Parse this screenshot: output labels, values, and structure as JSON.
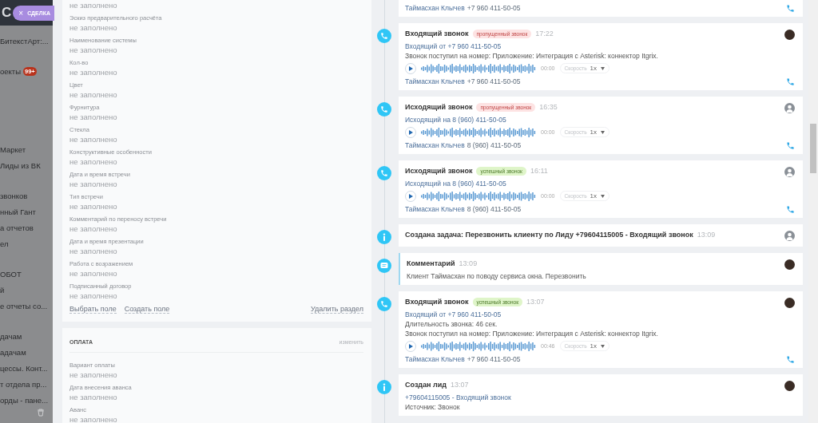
{
  "sidebar": {
    "logo": "С",
    "deal_tab": {
      "close": "×",
      "label": "СДЕЛКА"
    },
    "groups": [
      {
        "items": [
          {
            "label": "БитекстАрт:..."
          }
        ]
      },
      {
        "items": [
          {
            "label": "оекты",
            "badge": "99+"
          }
        ]
      },
      {
        "items": [
          {
            "label": "Маркет"
          },
          {
            "label": "Лиды из ВК"
          }
        ]
      },
      {
        "items": [
          {
            "label": "звонков"
          },
          {
            "label": "нный Гант"
          },
          {
            "label": "а отчетов"
          },
          {
            "label": "ел"
          }
        ]
      },
      {
        "items": [
          {
            "label": "ОБОТ"
          },
          {
            "label": "й"
          },
          {
            "label": "е отчеты со..."
          }
        ]
      },
      {
        "items": [
          {
            "label": "дачам"
          },
          {
            "label": "адачам"
          },
          {
            "label": "цессы. Конт..."
          },
          {
            "label": "т отдела пр..."
          },
          {
            "label": "орды - пане..."
          }
        ]
      }
    ]
  },
  "details": {
    "sections": [
      {
        "fields": [
          {
            "value": "не заполнено"
          },
          {
            "label": "Эскиз предварительного расчёта",
            "value": "не заполнено"
          },
          {
            "label": "Наименование системы",
            "value": "не заполнено"
          },
          {
            "label": "Кол-во",
            "value": "не заполнено"
          },
          {
            "label": "Цвет",
            "value": "не заполнено"
          },
          {
            "label": "Фурнитура",
            "value": "не заполнено"
          },
          {
            "label": "Стекла",
            "value": "не заполнено"
          },
          {
            "label": "Конструктивные особенности",
            "value": "не заполнено"
          },
          {
            "label": "Дата и время встречи",
            "value": "не заполнено"
          },
          {
            "label": "Тип встречи",
            "value": "не заполнено"
          },
          {
            "label": "Комментарий по переносу встречи",
            "value": "не заполнено"
          },
          {
            "label": "Дата и время презентации",
            "value": "не заполнено"
          },
          {
            "label": "Работа с возражением",
            "value": "не заполнено"
          },
          {
            "label": "Подписанный договор",
            "value": "не заполнено"
          }
        ],
        "footer": {
          "links": [
            "Выбрать поле",
            "Создать поле"
          ],
          "delete": "Удалить раздел"
        }
      },
      {
        "title": "ОПЛАТА",
        "edit": "изменить",
        "fields": [
          {
            "label": "Вариант оплаты",
            "value": "не заполнено"
          },
          {
            "label": "Дата внесения аванса",
            "value": "не заполнено"
          },
          {
            "label": "Аванс",
            "value": "не заполнено"
          }
        ]
      }
    ]
  },
  "timeline": [
    {
      "kind": "call",
      "contact": {
        "name": "Таймасхан Клычев",
        "phone": "+7 960 411-50-05"
      }
    },
    {
      "kind": "call",
      "avatar": {
        "kind": "photo"
      },
      "title": "Входящий звонок",
      "badge": {
        "text": "пропущенный звонок",
        "kind": "missed"
      },
      "time": "17:22",
      "lines": [
        {
          "kind": "link",
          "text": "Входящий от +7 960 411-50-05"
        },
        {
          "kind": "text",
          "text": "Звонок поступил на номер: Приложение: Интеграция с Asterisk: коннектор Itgrix."
        }
      ],
      "player": {
        "time": "00:00",
        "speed_label": "Скорость",
        "speed": "1x"
      },
      "contact": {
        "name": "Таймасхан Клычев",
        "phone": "+7 960 411-50-05"
      }
    },
    {
      "kind": "call",
      "avatar": {
        "kind": "generic"
      },
      "title": "Исходящий звонок",
      "badge": {
        "text": "пропущенный звонок",
        "kind": "missed"
      },
      "time": "16:35",
      "lines": [
        {
          "kind": "link",
          "text": "Исходящий на 8 (960) 411-50-05"
        }
      ],
      "player": {
        "time": "00:00",
        "speed_label": "Скорость",
        "speed": "1x"
      },
      "contact": {
        "name": "Таймасхан Клычев",
        "phone": "8 (960) 411-50-05"
      }
    },
    {
      "kind": "call",
      "avatar": {
        "kind": "generic"
      },
      "title": "Исходящий звонок",
      "badge": {
        "text": "успешный звонок",
        "kind": "success"
      },
      "time": "16:11",
      "lines": [
        {
          "kind": "link",
          "text": "Исходящий на 8 (960) 411-50-05"
        }
      ],
      "player": {
        "time": "00:00",
        "speed_label": "Скорость",
        "speed": "1x"
      },
      "contact": {
        "name": "Таймасхан Клычев",
        "phone": "8 (960) 411-50-05"
      }
    },
    {
      "kind": "task",
      "avatar": {
        "kind": "generic"
      },
      "title": "Создана задача: Перезвонить клиенту по Лиду +79604115005 - Входящий звонок",
      "time": "13:09"
    },
    {
      "kind": "comment",
      "avatar": {
        "kind": "photo"
      },
      "title": "Комментарий",
      "time": "13:09",
      "lines": [
        {
          "kind": "text",
          "text": "Клиент Таймасхан по поводу сервиса окна. Перезвонить"
        }
      ]
    },
    {
      "kind": "call",
      "avatar": {
        "kind": "photo"
      },
      "title": "Входящий звонок",
      "badge": {
        "text": "успешный звонок",
        "kind": "success"
      },
      "time": "13:07",
      "lines": [
        {
          "kind": "link",
          "text": "Входящий от +7 960 411-50-05"
        },
        {
          "kind": "text",
          "text": "Длительность звонка: 46 сек."
        },
        {
          "kind": "text",
          "text": "Звонок поступил на номер: Приложение: Интеграция с Asterisk: коннектор Itgrix."
        }
      ],
      "player": {
        "time": "00:46",
        "speed_label": "Скорость",
        "speed": "1x"
      },
      "contact": {
        "name": "Таймасхан Клычев",
        "phone": "+7 960 411-50-05"
      }
    },
    {
      "kind": "lead",
      "avatar": {
        "kind": "photo"
      },
      "title": "Создан лид",
      "time": "13:07",
      "lines": [
        {
          "kind": "link",
          "text": "+79604115005 - Входящий звонок"
        },
        {
          "kind": "text",
          "text": "Источник: Звонок"
        }
      ]
    }
  ]
}
